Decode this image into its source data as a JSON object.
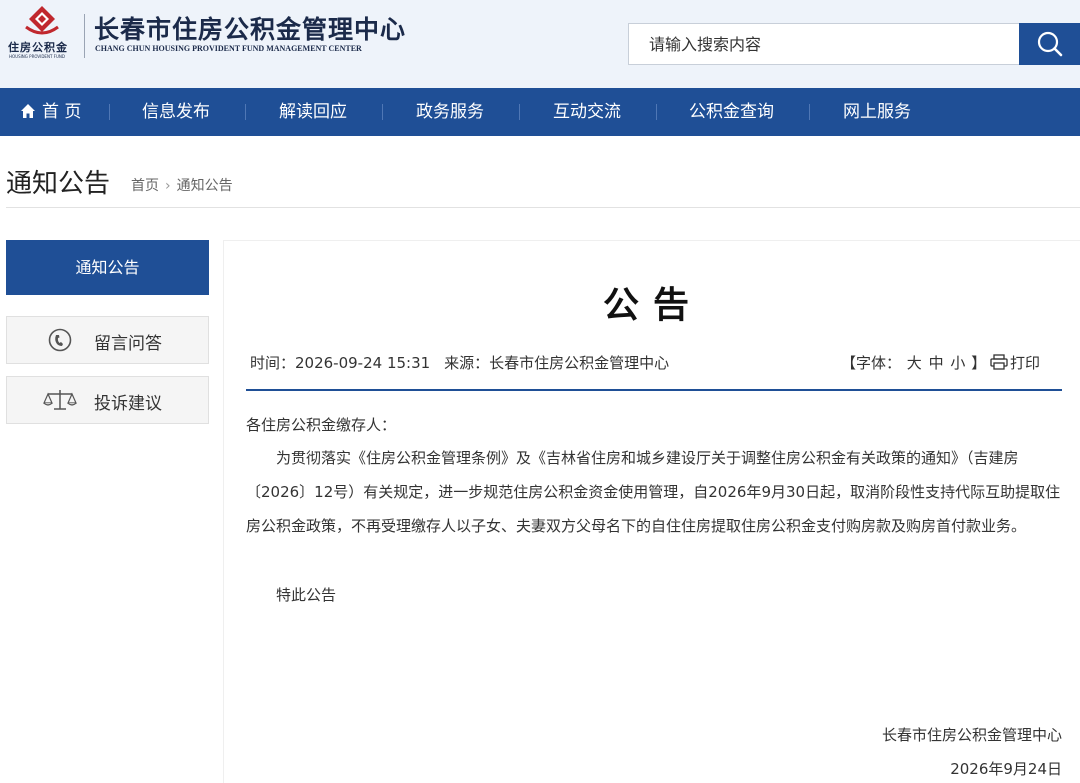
{
  "header": {
    "logo_cn": "住房公积金",
    "logo_en": "HOUSING PROVIDENT FUND",
    "site_title": "长春市住房公积金管理中心",
    "site_subtitle": "CHANG CHUN HOUSING PROVIDENT FUND MANAGEMENT CENTER",
    "search_placeholder": "请输入搜索内容",
    "search_icon": "search-icon"
  },
  "nav": {
    "items": [
      {
        "label": "首 页",
        "icon": "home-icon"
      },
      {
        "label": "信息发布"
      },
      {
        "label": "解读回应"
      },
      {
        "label": "政务服务"
      },
      {
        "label": "互动交流"
      },
      {
        "label": "公积金查询"
      },
      {
        "label": "网上服务"
      }
    ]
  },
  "page": {
    "title": "通知公告",
    "breadcrumb": [
      "首页",
      "通知公告"
    ],
    "breadcrumb_sep": "›"
  },
  "sidebar": {
    "active": "通知公告",
    "items": [
      {
        "label": "留言问答",
        "icon": "phone-icon"
      },
      {
        "label": "投诉建议",
        "icon": "scales-icon"
      }
    ]
  },
  "article": {
    "title": "公告",
    "time_label": "时间：2026-09-24 15:31",
    "source_label": "来源：长春市住房公积金管理中心",
    "font_prefix": "【字体：",
    "font_large": "大",
    "font_medium": "中",
    "font_small": "小",
    "font_suffix": "】",
    "print_label": "打印",
    "salutation": "各住房公积金缴存人：",
    "paragraph": "为贯彻落实《住房公积金管理条例》及《吉林省住房和城乡建设厅关于调整住房公积金有关政策的通知》（吉建房〔2026〕12号）有关规定，进一步规范住房公积金资金使用管理，自2026年9月30日起，取消阶段性支持代际互助提取住房公积金政策，不再受理缴存人以子女、夫妻双方父母名下的自住住房提取住房公积金支付购房款及购房首付款业务。",
    "closing": "特此公告",
    "signature": "长春市住房公积金管理中心",
    "date": "2026年9月24日"
  },
  "colors": {
    "brand_blue": "#1f4f96",
    "header_bg": "#eef3fa",
    "logo_red": "#c0282e"
  }
}
